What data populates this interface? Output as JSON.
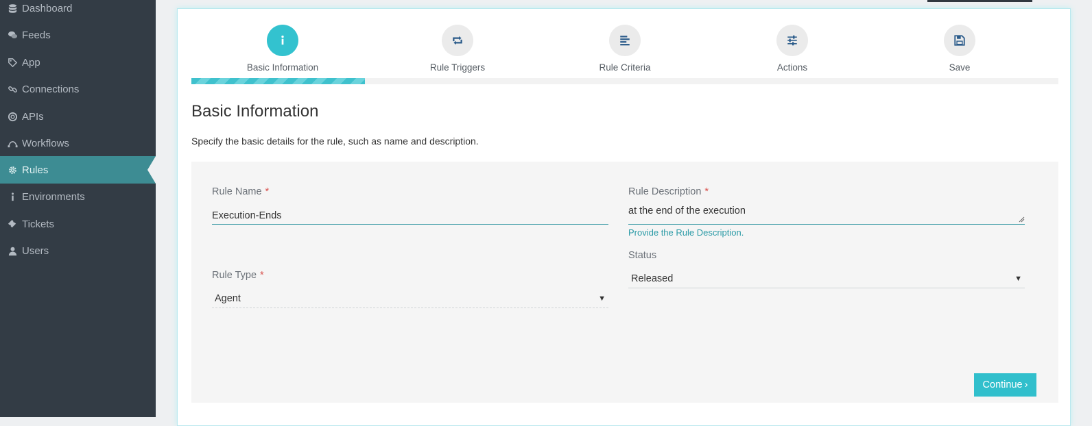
{
  "sidebar": {
    "items": [
      {
        "label": "Dashboard",
        "icon": "database-icon"
      },
      {
        "label": "Feeds",
        "icon": "chat-icon"
      },
      {
        "label": "App",
        "icon": "tag-icon"
      },
      {
        "label": "Connections",
        "icon": "link-icon"
      },
      {
        "label": "APIs",
        "icon": "life-ring-icon"
      },
      {
        "label": "Workflows",
        "icon": "workflow-icon"
      },
      {
        "label": "Rules",
        "icon": "gear-icon",
        "active": true
      },
      {
        "label": "Environments",
        "icon": "info-icon"
      },
      {
        "label": "Tickets",
        "icon": "ticket-icon"
      },
      {
        "label": "Users",
        "icon": "user-icon"
      }
    ]
  },
  "wizard": {
    "steps": [
      {
        "label": "Basic Information",
        "icon": "info-icon",
        "active": true
      },
      {
        "label": "Rule Triggers",
        "icon": "retweet-icon"
      },
      {
        "label": "Rule Criteria",
        "icon": "align-left-icon"
      },
      {
        "label": "Actions",
        "icon": "sliders-icon"
      },
      {
        "label": "Save",
        "icon": "floppy-icon"
      }
    ],
    "progress_percent": 20
  },
  "page": {
    "title": "Basic Information",
    "subtitle": "Specify the basic details for the rule, such as name and description."
  },
  "form": {
    "rule_name_label": "Rule Name",
    "rule_name_value": "Execution-Ends",
    "rule_description_label": "Rule Description",
    "rule_description_value": "at the end of the execution",
    "rule_description_help": "Provide the Rule Description.",
    "rule_type_label": "Rule Type",
    "rule_type_value": "Agent",
    "status_label": "Status",
    "status_value": "Released",
    "required_marker": "*",
    "continue_label": "Continue"
  },
  "colors": {
    "accent": "#33c2cf",
    "sidebar_bg": "#333c45",
    "sidebar_active": "#3d8c93",
    "required": "#d9534f"
  }
}
